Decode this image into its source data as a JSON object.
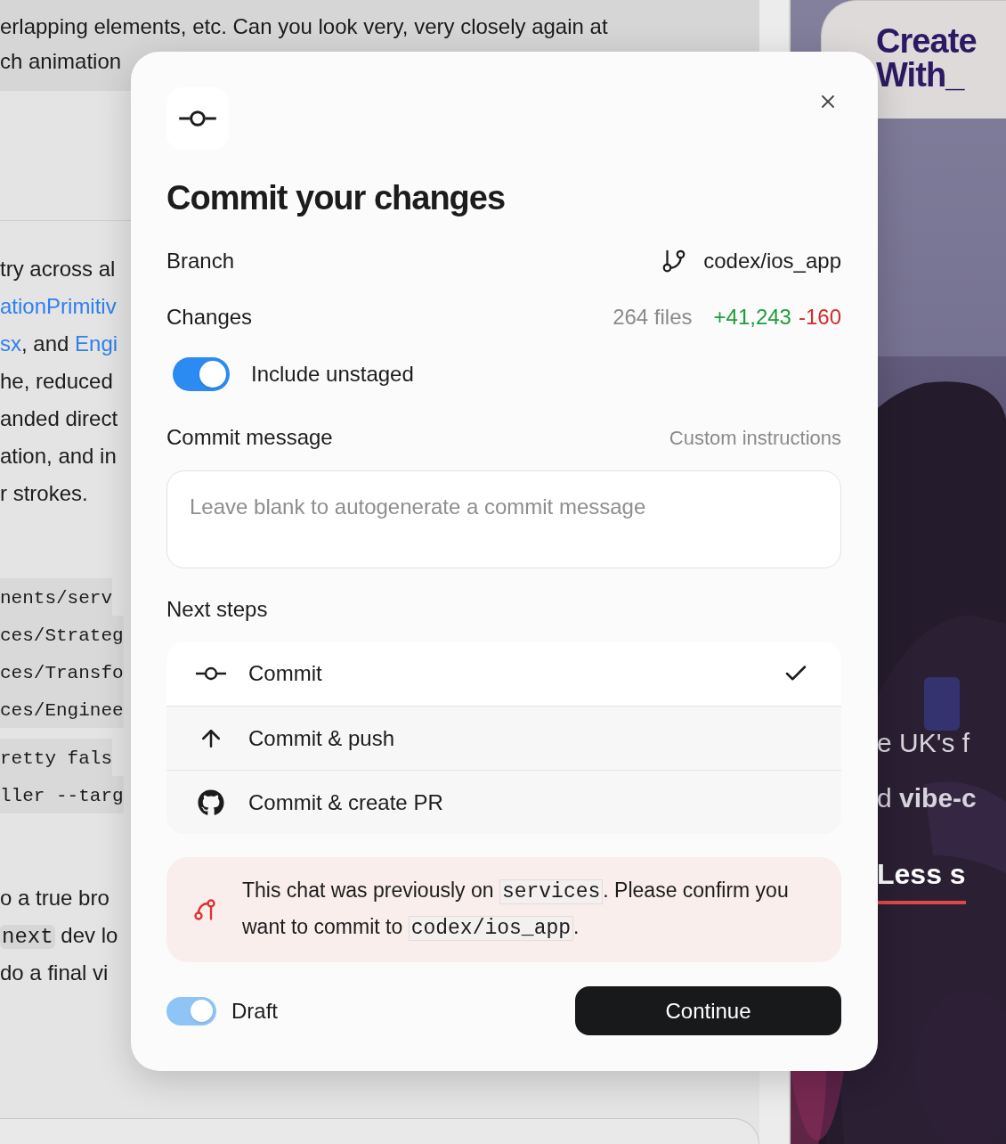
{
  "background": {
    "bubble_lines": [
      {
        "segments": [
          {
            "text": "erlapping elements, etc. Can you look very, very closely again at",
            "kind": "plain"
          }
        ]
      },
      {
        "segments": [
          {
            "text": "ch animation",
            "kind": "plain"
          }
        ]
      }
    ],
    "blocks": [
      {
        "kind": "prose",
        "lines": [
          {
            "segments": [
              {
                "text": "try across al",
                "kind": "plain"
              }
            ]
          },
          {
            "segments": [
              {
                "text": "ationPrimitiv",
                "kind": "link"
              }
            ]
          },
          {
            "segments": [
              {
                "text": "sx",
                "kind": "link"
              },
              {
                "text": ", and ",
                "kind": "plain"
              },
              {
                "text": "Engi",
                "kind": "link"
              }
            ]
          },
          {
            "segments": [
              {
                "text": "he, reduced",
                "kind": "plain"
              }
            ]
          },
          {
            "segments": [
              {
                "text": "anded direct",
                "kind": "plain"
              }
            ]
          },
          {
            "segments": [
              {
                "text": "ation, and in",
                "kind": "plain"
              }
            ]
          },
          {
            "segments": [
              {
                "text": "r strokes.",
                "kind": "plain"
              }
            ]
          }
        ]
      },
      {
        "kind": "code",
        "lines": [
          {
            "segments": [
              {
                "text": "nents/serv",
                "kind": "code"
              }
            ]
          },
          {
            "segments": [
              {
                "text": "ces/Strateg",
                "kind": "code"
              }
            ]
          },
          {
            "segments": [
              {
                "text": "ces/Transfo",
                "kind": "code"
              }
            ]
          },
          {
            "segments": [
              {
                "text": "ces/Enginee",
                "kind": "code"
              }
            ]
          }
        ]
      },
      {
        "kind": "code",
        "lines": [
          {
            "segments": [
              {
                "text": "retty fals",
                "kind": "code"
              }
            ]
          },
          {
            "segments": [
              {
                "text": "ller --targ",
                "kind": "code"
              }
            ]
          }
        ]
      },
      {
        "kind": "prose",
        "lines": [
          {
            "segments": [
              {
                "text": "o a true bro",
                "kind": "plain"
              }
            ]
          },
          {
            "segments": [
              {
                "text": "next",
                "kind": "code"
              },
              {
                "text": " dev lo",
                "kind": "plain"
              }
            ]
          },
          {
            "segments": [
              {
                "text": "do a final vi",
                "kind": "plain"
              }
            ]
          }
        ]
      }
    ],
    "site": {
      "logo": "Create With_",
      "lines": [
        {
          "segments": [
            {
              "text": "e UK's f",
              "kind": "plain"
            }
          ]
        },
        {
          "segments": [
            {
              "text": "d ",
              "kind": "plain"
            },
            {
              "text": "vibe-c",
              "kind": "bold"
            }
          ]
        }
      ],
      "link": "Less s"
    }
  },
  "dialog": {
    "title": "Commit your changes",
    "branch": {
      "label": "Branch",
      "value": "codex/ios_app"
    },
    "changes": {
      "label": "Changes",
      "files": "264 files",
      "added": "+41,243",
      "removed": "-160"
    },
    "include_unstaged": {
      "label": "Include unstaged",
      "on": true
    },
    "commit_message": {
      "label": "Commit message",
      "link": "Custom instructions",
      "placeholder": "Leave blank to autogenerate a commit message"
    },
    "next_steps": {
      "label": "Next steps",
      "options": [
        {
          "kind": "commit",
          "label": "Commit",
          "selected": true
        },
        {
          "kind": "push",
          "label": "Commit & push",
          "selected": false
        },
        {
          "kind": "pr",
          "label": "Commit & create PR",
          "selected": false
        }
      ]
    },
    "warning": {
      "segments": [
        {
          "text": "This chat was previously on ",
          "kind": "plain"
        },
        {
          "text": "services",
          "kind": "code"
        },
        {
          "text": ". Please confirm you want to commit to ",
          "kind": "plain"
        },
        {
          "text": "codex/ios_app",
          "kind": "code"
        },
        {
          "text": ".",
          "kind": "plain"
        }
      ]
    },
    "draft": {
      "label": "Draft",
      "on": true
    },
    "continue": "Continue"
  }
}
